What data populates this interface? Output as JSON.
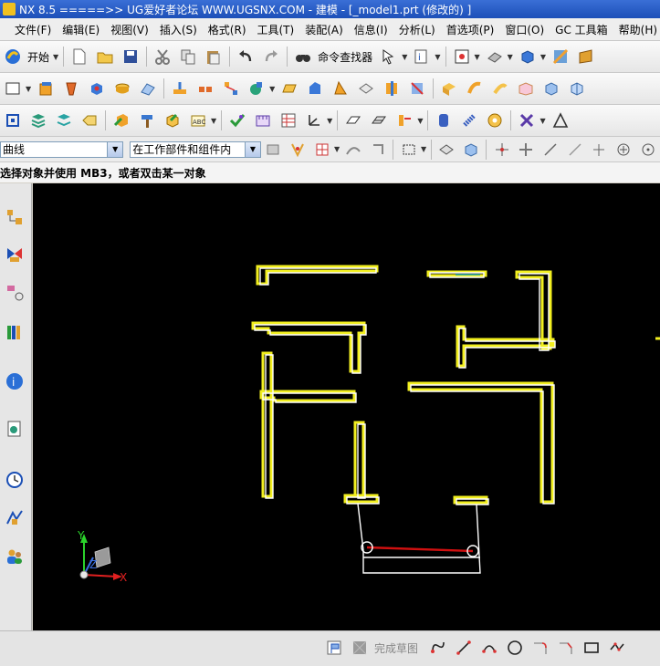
{
  "window": {
    "title": "NX 8.5  =====>>  UG爱好者论坛  WWW.UGSNX.COM - 建模 - [_model1.prt  (修改的) ]"
  },
  "menu": {
    "items": [
      "文件(F)",
      "编辑(E)",
      "视图(V)",
      "插入(S)",
      "格式(R)",
      "工具(T)",
      "装配(A)",
      "信息(I)",
      "分析(L)",
      "首选项(P)",
      "窗口(O)",
      "GC 工具箱",
      "帮助(H)"
    ]
  },
  "toolbar": {
    "start_label": "开始",
    "command_finder_label": "命令查找器"
  },
  "selection": {
    "type_filter": "曲线",
    "scope": "在工作部件和组件内"
  },
  "cue_line": "选择对象并使用 MB3，或者双击某一对象",
  "sketch": {
    "finish_label": "完成草图"
  },
  "triad": {
    "x_label": "X",
    "y_label": "Y",
    "z_label": "Z"
  },
  "colors": {
    "viewport_bg": "#000000",
    "wall_highlight": "#f2ef20",
    "wall_outline": "#ffffff",
    "red_line": "#d01010"
  }
}
